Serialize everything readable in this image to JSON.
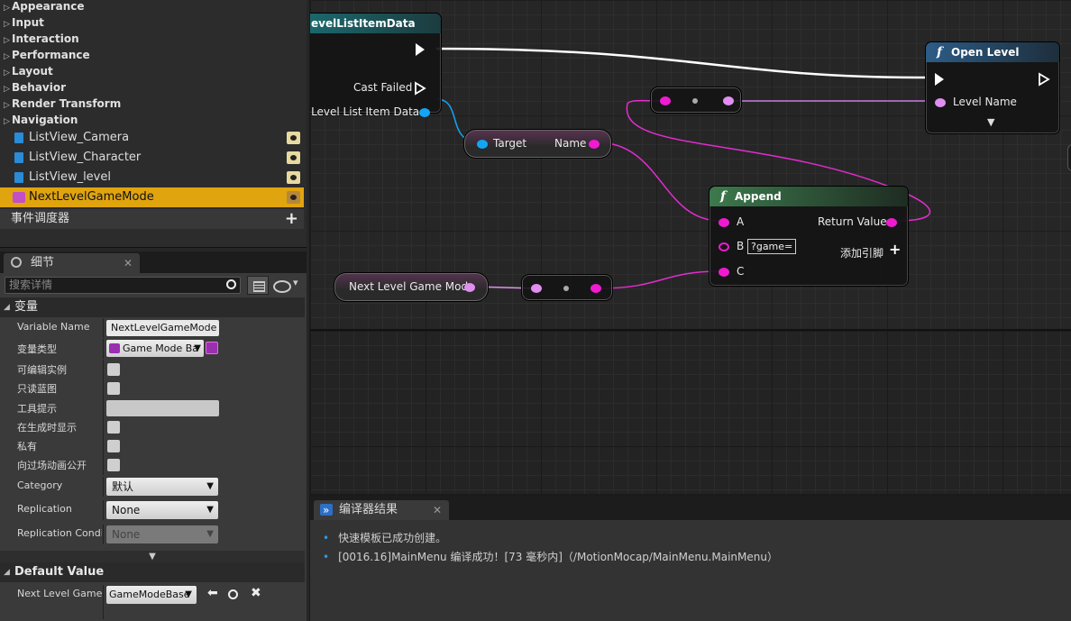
{
  "my_blueprint": {
    "categories": [
      "Appearance",
      "Input",
      "Interaction",
      "Performance",
      "Layout",
      "Behavior",
      "Render Transform",
      "Navigation"
    ],
    "variables": [
      {
        "name": "ListView_Camera"
      },
      {
        "name": "ListView_Character"
      },
      {
        "name": "ListView_level"
      },
      {
        "name": "NextLevelGameMode"
      }
    ],
    "event_dispatchers": "事件调度器"
  },
  "details": {
    "tab_label": "细节",
    "search_placeholder": "搜索详情",
    "section_variable": "变量",
    "rows": {
      "variable_name_label": "Variable Name",
      "variable_name_value": "NextLevelGameMode",
      "variable_type_label": "变量类型",
      "variable_type_value": "Game Mode Ba",
      "editable_label": "可编辑实例",
      "readonly_label": "只读蓝图",
      "tooltip_label": "工具提示",
      "expose_spawn_label": "在生成时显示",
      "private_label": "私有",
      "expose_cinematics_label": "向过场动画公开",
      "category_label": "Category",
      "category_value": "默认",
      "replication_label": "Replication",
      "replication_value": "None",
      "replication_condition_label": "Replication Conditi",
      "replication_condition_value": "None"
    },
    "section_default": "Default Value",
    "default_label": "Next Level Game M",
    "default_value": "GameModeBase"
  },
  "graph": {
    "cast_node": {
      "title": "evelListItemData",
      "cast_failed": "Cast Failed",
      "output_pin": "s Level List Item Data"
    },
    "open_level_node": {
      "title": "Open Level",
      "level_name": "Level Name"
    },
    "target_node": {
      "target": "Target",
      "name": "Name"
    },
    "append_node": {
      "title": "Append",
      "pin_a": "A",
      "pin_b": "B",
      "pin_b_value": "?game=",
      "pin_c": "C",
      "return_value": "Return Value",
      "add_pin": "添加引脚"
    },
    "var_node": {
      "label": "Next Level Game Mode"
    }
  },
  "compiler": {
    "tab_label": "编译器结果",
    "messages": [
      "快速模板已成功创建。",
      "[0016.16]MainMenu 编译成功！[73 毫秒内]（/MotionMocap/MainMenu.MainMenu）"
    ]
  },
  "colors": {
    "selected": "#e0a40f",
    "string_pin": "#f01ad2",
    "object_pin": "#14a4f4",
    "class_pin": "#e08ff0"
  }
}
